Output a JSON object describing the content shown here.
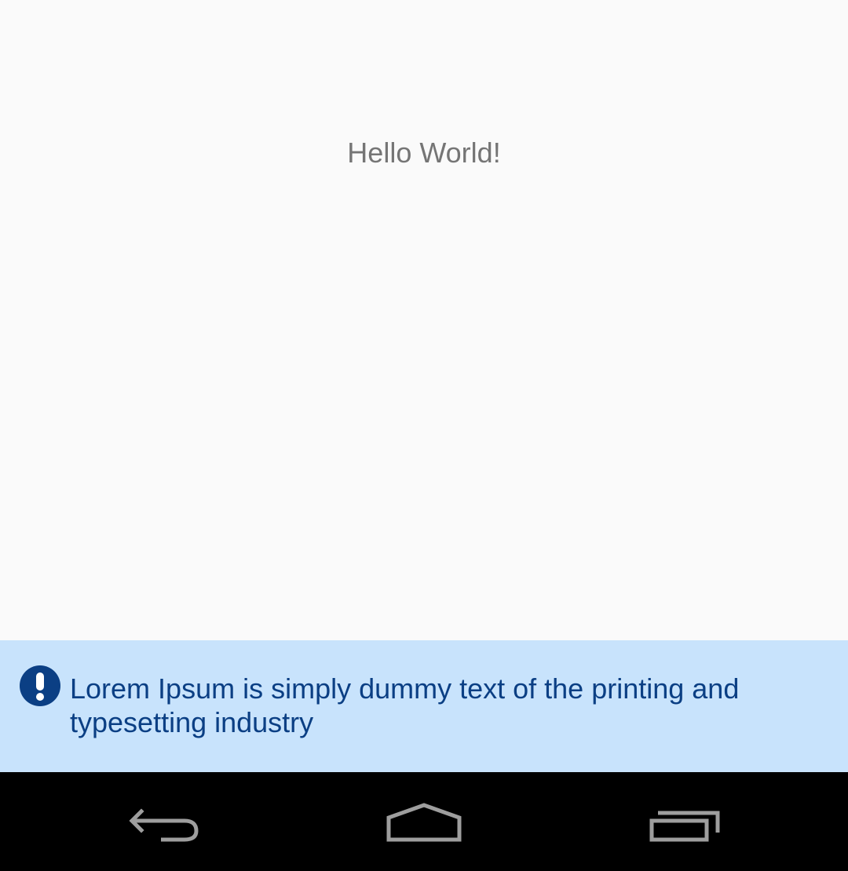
{
  "main": {
    "greeting": "Hello World!"
  },
  "banner": {
    "message": "Lorem Ipsum is simply dummy text of the printing and typesetting industry",
    "icon": "exclamation-circle-icon",
    "background_color": "#c8e3fc",
    "text_color": "#0b3f84"
  },
  "navbar": {
    "buttons": [
      {
        "icon": "back-icon"
      },
      {
        "icon": "home-icon"
      },
      {
        "icon": "recent-apps-icon"
      }
    ]
  }
}
